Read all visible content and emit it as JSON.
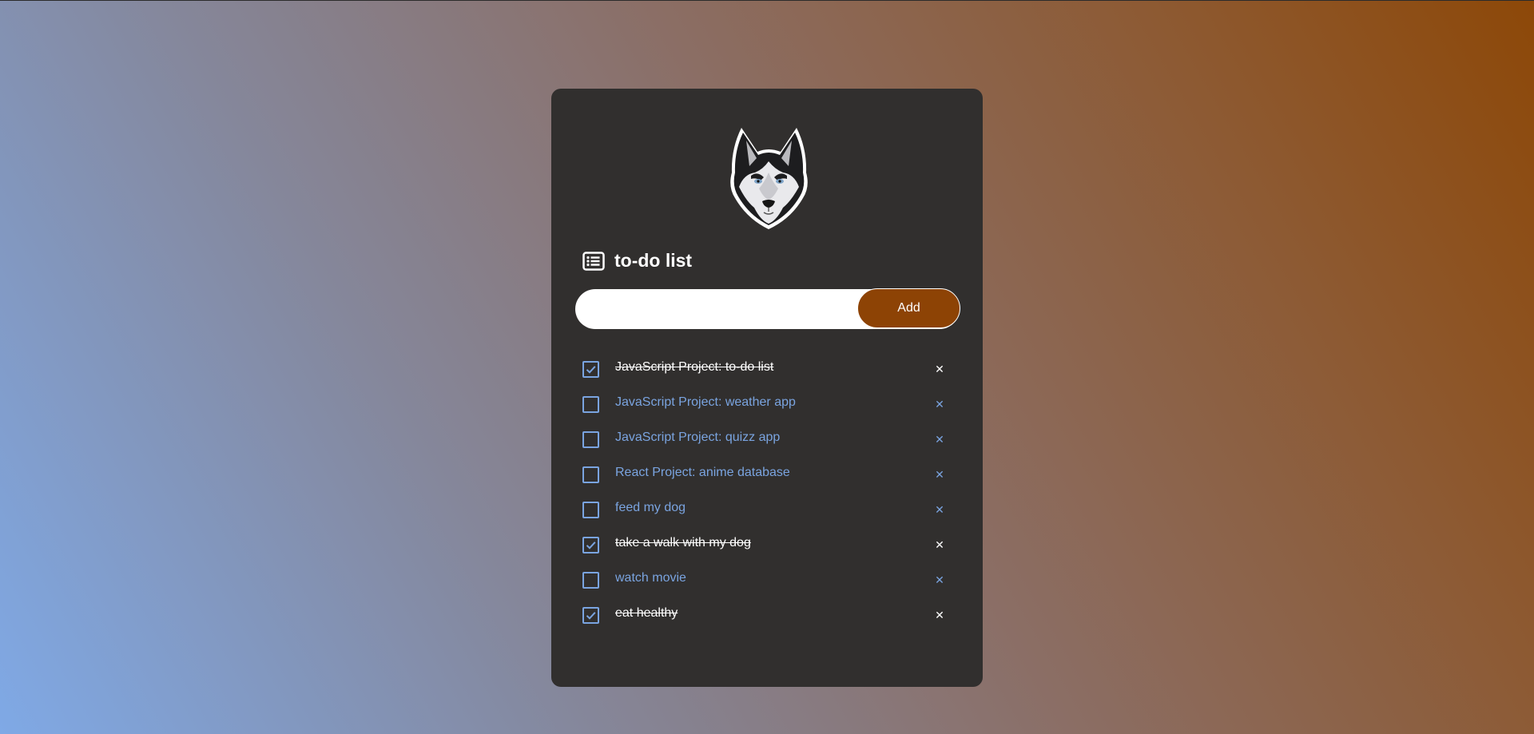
{
  "app": {
    "title": "to-do list"
  },
  "input": {
    "value": "",
    "placeholder": ""
  },
  "add_button": {
    "label": "Add"
  },
  "icons": {
    "logo": "husky-dog-logo",
    "title": "list-icon",
    "check": "checkmark-icon",
    "delete": "close-icon",
    "delete_glyph": "✕"
  },
  "colors": {
    "card_background": "#312f2e",
    "accent": "#8d4305",
    "task_text": "#7aa4e0",
    "done_text": "#ffffff"
  },
  "tasks": [
    {
      "label": "JavaScript Project: to-do list",
      "done": true
    },
    {
      "label": "JavaScript Project: weather app",
      "done": false
    },
    {
      "label": "JavaScript Project: quizz app",
      "done": false
    },
    {
      "label": "React Project: anime database",
      "done": false
    },
    {
      "label": "feed my dog",
      "done": false
    },
    {
      "label": "take a walk with my dog",
      "done": true
    },
    {
      "label": "watch movie",
      "done": false
    },
    {
      "label": "eat healthy",
      "done": true
    }
  ]
}
